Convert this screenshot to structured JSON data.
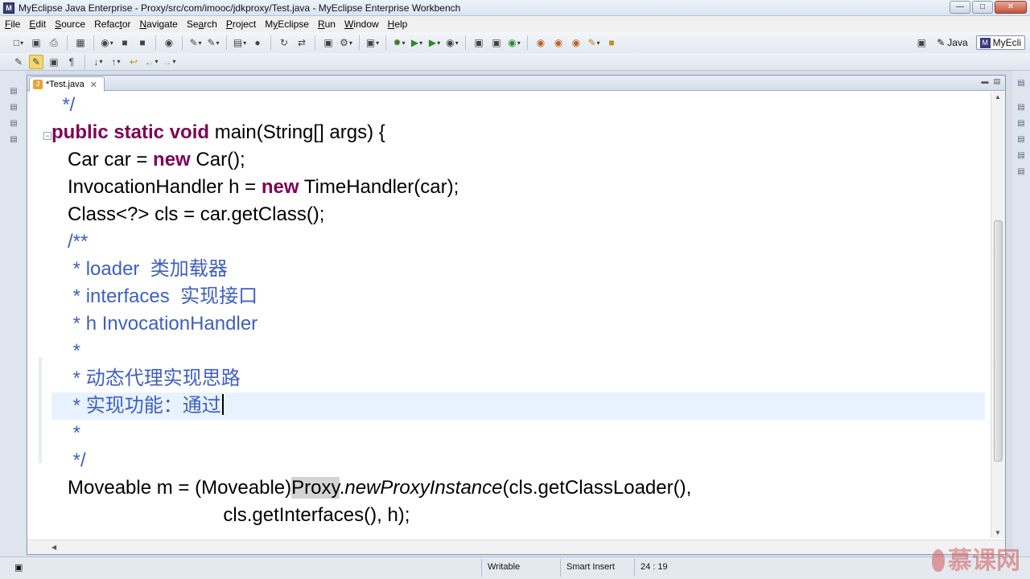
{
  "window": {
    "title": "MyEclipse Java Enterprise - Proxy/src/com/imooc/jdkproxy/Test.java - MyEclipse Enterprise Workbench"
  },
  "menu": [
    {
      "label": "File",
      "mnemonic": "F"
    },
    {
      "label": "Edit",
      "mnemonic": "E"
    },
    {
      "label": "Source",
      "mnemonic": "S"
    },
    {
      "label": "Refactor",
      "mnemonic": "t"
    },
    {
      "label": "Navigate",
      "mnemonic": "N"
    },
    {
      "label": "Search",
      "mnemonic": "a"
    },
    {
      "label": "Project",
      "mnemonic": "P"
    },
    {
      "label": "MyEclipse",
      "mnemonic": "y"
    },
    {
      "label": "Run",
      "mnemonic": "R"
    },
    {
      "label": "Window",
      "mnemonic": "W"
    },
    {
      "label": "Help",
      "mnemonic": "H"
    }
  ],
  "perspectives": {
    "java": "Java",
    "myeclipse": "MyEcli"
  },
  "editor": {
    "tab_label": "*Test.java",
    "lines": [
      {
        "tokens": [
          {
            "t": "*/",
            "c": "cm"
          }
        ],
        "indent": "  "
      },
      {
        "tokens": [
          {
            "t": "public static void",
            "c": "kw"
          },
          {
            "t": " main(String[] args) {",
            "c": ""
          }
        ],
        "indent": ""
      },
      {
        "tokens": [
          {
            "t": "Car car = ",
            "c": ""
          },
          {
            "t": "new",
            "c": "kw"
          },
          {
            "t": " Car();",
            "c": ""
          }
        ],
        "indent": "   "
      },
      {
        "tokens": [
          {
            "t": "InvocationHandler h = ",
            "c": ""
          },
          {
            "t": "new",
            "c": "kw"
          },
          {
            "t": " TimeHandler(car);",
            "c": ""
          }
        ],
        "indent": "   "
      },
      {
        "tokens": [
          {
            "t": "Class<?> cls = car.getClass();",
            "c": ""
          }
        ],
        "indent": "   "
      },
      {
        "tokens": [
          {
            "t": "/**",
            "c": "cm"
          }
        ],
        "indent": "   "
      },
      {
        "tokens": [
          {
            "t": " * loader  类加载器",
            "c": "cm"
          }
        ],
        "indent": "   "
      },
      {
        "tokens": [
          {
            "t": " * interfaces  实现接口",
            "c": "cm"
          }
        ],
        "indent": "   "
      },
      {
        "tokens": [
          {
            "t": " * h InvocationHandler",
            "c": "cm"
          }
        ],
        "indent": "   "
      },
      {
        "tokens": [
          {
            "t": " *",
            "c": "cm"
          }
        ],
        "indent": "   "
      },
      {
        "tokens": [
          {
            "t": " * 动态代理实现思路",
            "c": "cm"
          }
        ],
        "indent": "   "
      },
      {
        "tokens": [
          {
            "t": " * 实现功能：通过",
            "c": "cm"
          }
        ],
        "indent": "   ",
        "current": true
      },
      {
        "tokens": [
          {
            "t": " *",
            "c": "cm"
          }
        ],
        "indent": "   "
      },
      {
        "tokens": [
          {
            "t": " */",
            "c": "cm"
          }
        ],
        "indent": "   "
      },
      {
        "tokens": [
          {
            "t": "Moveable m = (Moveable)",
            "c": ""
          },
          {
            "t": "Proxy",
            "c": "hl"
          },
          {
            "t": ".",
            "c": ""
          },
          {
            "t": "newProxyInstance",
            "c": "it"
          },
          {
            "t": "(cls.getClassLoader(),",
            "c": ""
          }
        ],
        "indent": "   "
      },
      {
        "tokens": [
          {
            "t": "cls.getInterfaces(), h);",
            "c": ""
          }
        ],
        "indent": "                                "
      }
    ]
  },
  "status": {
    "writable": "Writable",
    "insert_mode": "Smart Insert",
    "position": "24 : 19"
  },
  "watermark": {
    "text": "慕课网"
  }
}
